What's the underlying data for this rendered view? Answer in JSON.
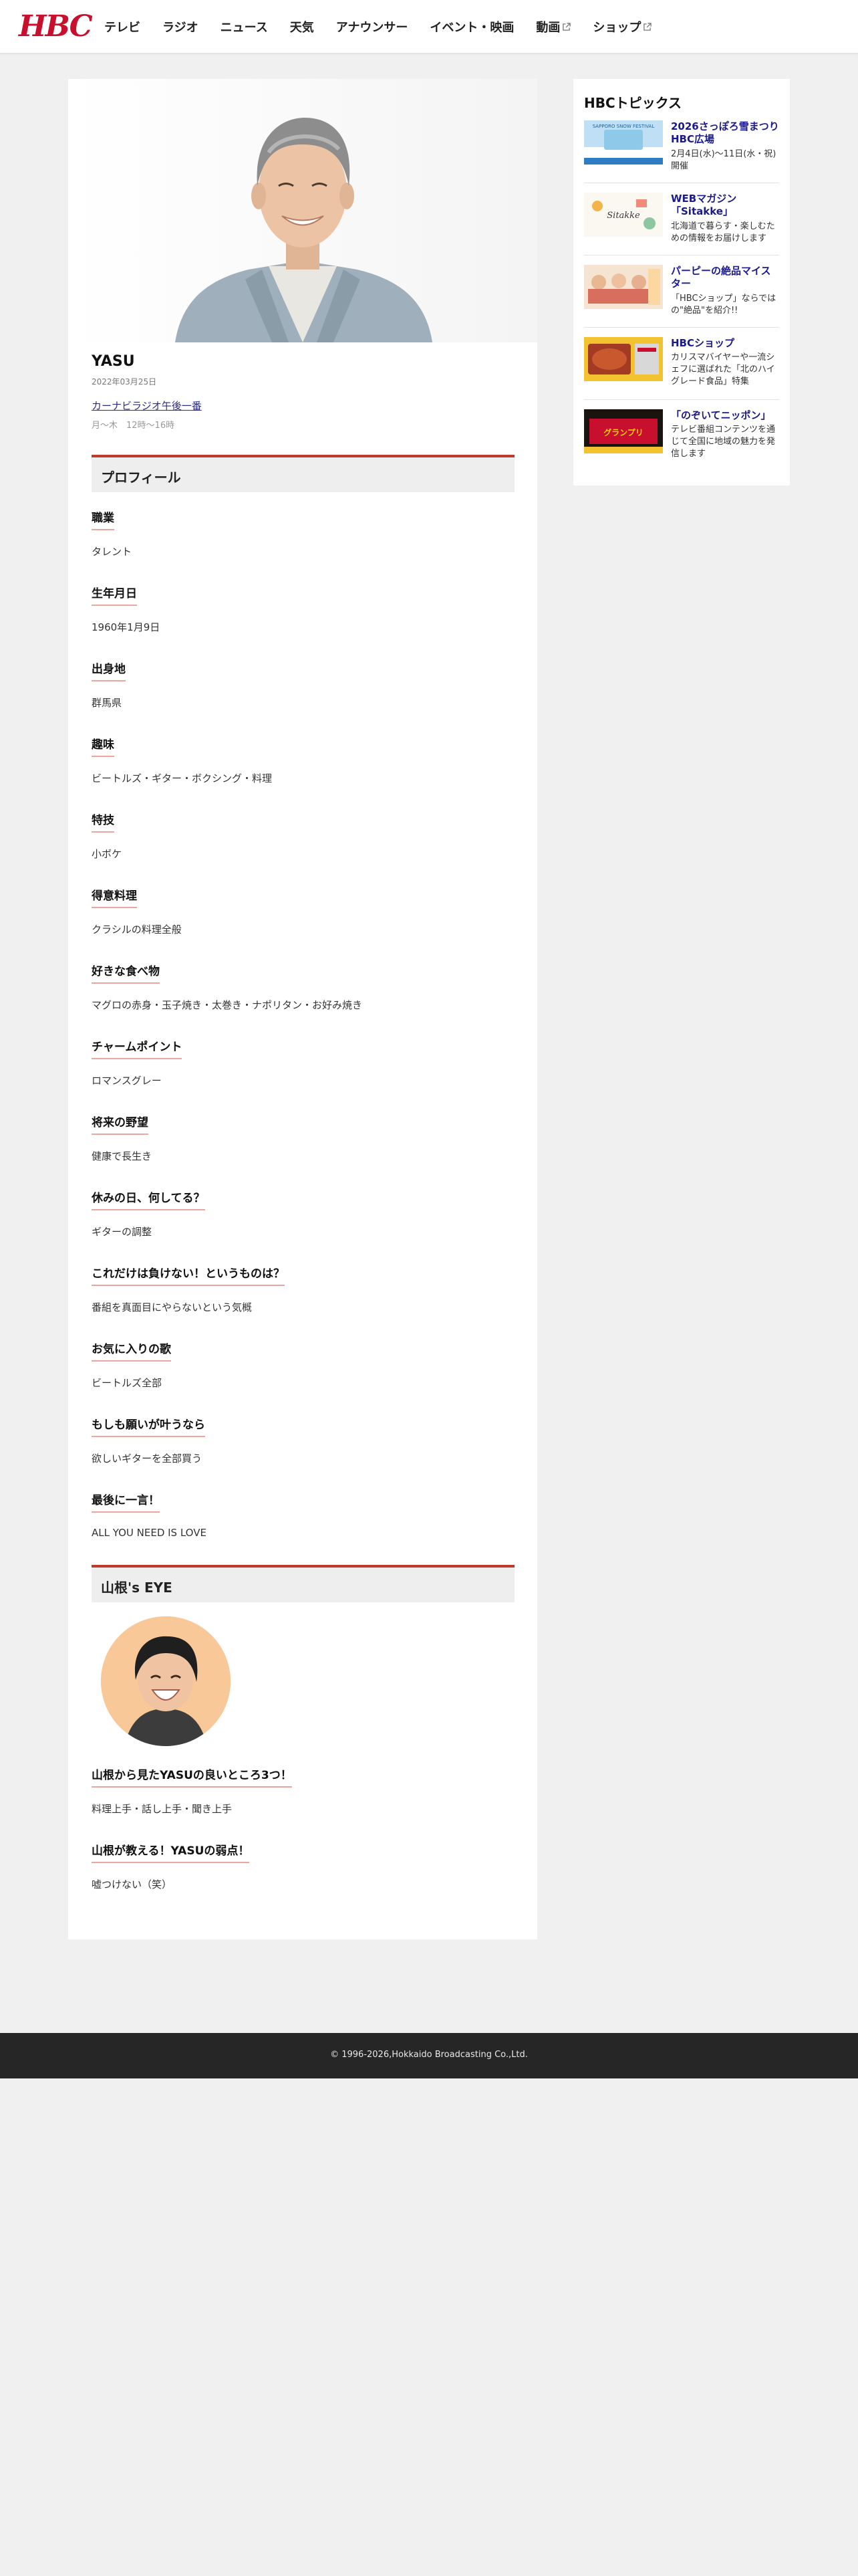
{
  "header": {
    "logo": "HBC",
    "nav": [
      {
        "label": "テレビ",
        "external": false
      },
      {
        "label": "ラジオ",
        "external": false
      },
      {
        "label": "ニュース",
        "external": false
      },
      {
        "label": "天気",
        "external": false
      },
      {
        "label": "アナウンサー",
        "external": false
      },
      {
        "label": "イベント・映画",
        "external": false
      },
      {
        "label": "動画",
        "external": true
      },
      {
        "label": "ショップ",
        "external": true
      }
    ]
  },
  "profile": {
    "name": "YASU",
    "date": "2022年03月25日",
    "program_link": "カーナビラジオ午後一番",
    "program_time": "月〜木　12時〜16時",
    "section_title": "プロフィール",
    "items": [
      {
        "label": "職業",
        "value": "タレント"
      },
      {
        "label": "生年月日",
        "value": "1960年1月9日"
      },
      {
        "label": "出身地",
        "value": "群馬県"
      },
      {
        "label": "趣味",
        "value": "ビートルズ・ギター・ボクシング・料理"
      },
      {
        "label": "特技",
        "value": "小ボケ"
      },
      {
        "label": "得意料理",
        "value": "クラシルの料理全般"
      },
      {
        "label": "好きな食べ物",
        "value": "マグロの赤身・玉子焼き・太巻き・ナポリタン・お好み焼き"
      },
      {
        "label": "チャームポイント",
        "value": "ロマンスグレー"
      },
      {
        "label": "将来の野望",
        "value": "健康で長生き"
      },
      {
        "label": "休みの日、何してる？",
        "value": "ギターの調整"
      },
      {
        "label": "これだけは負けない！というものは？",
        "value": "番組を真面目にやらないという気概"
      },
      {
        "label": "お気に入りの歌",
        "value": "ビートルズ全部"
      },
      {
        "label": "もしも願いが叶うなら",
        "value": "欲しいギターを全部買う"
      },
      {
        "label": "最後に一言！",
        "value": "ALL YOU NEED IS LOVE"
      }
    ]
  },
  "eye": {
    "section_title": "山根's EYE",
    "items": [
      {
        "label": "山根から見たYASUの良いところ3つ！",
        "value": "料理上手・話し上手・聞き上手"
      },
      {
        "label": "山根が教える！YASUの弱点！",
        "value": "嘘つけない（笑）"
      }
    ]
  },
  "sidebar": {
    "title": "HBCトピックス",
    "topics": [
      {
        "title": "2026さっぽろ雪まつりHBC広場",
        "desc": "2月4日(水)〜11日(水・祝)開催"
      },
      {
        "title": "WEBマガジン「Sitakke」",
        "desc": "北海道で暮らす・楽しむための情報をお届けします"
      },
      {
        "title": "パーピーの絶品マイスター",
        "desc": "「HBCショップ」ならではの\"絶品\"を紹介!!"
      },
      {
        "title": "HBCショップ",
        "desc": "カリスマバイヤーや一流シェフに選ばれた「北のハイグレード食品」特集"
      },
      {
        "title": "「のぞいてニッポン」",
        "desc": "テレビ番組コンテンツを通じて全国に地域の魅力を発信します"
      }
    ],
    "thumb_texts": [
      "SAPPORO SNOW FESTIVAL",
      "Sitakke",
      "",
      "",
      "グランプリ"
    ]
  },
  "footer": {
    "copyright": "© 1996-2026,Hokkaido Broadcasting Co.,Ltd."
  },
  "colors": {
    "brand_red": "#c8102e",
    "section_red": "#c0392b",
    "link_navy": "#1a1a8c",
    "footer_bg": "#262626"
  }
}
